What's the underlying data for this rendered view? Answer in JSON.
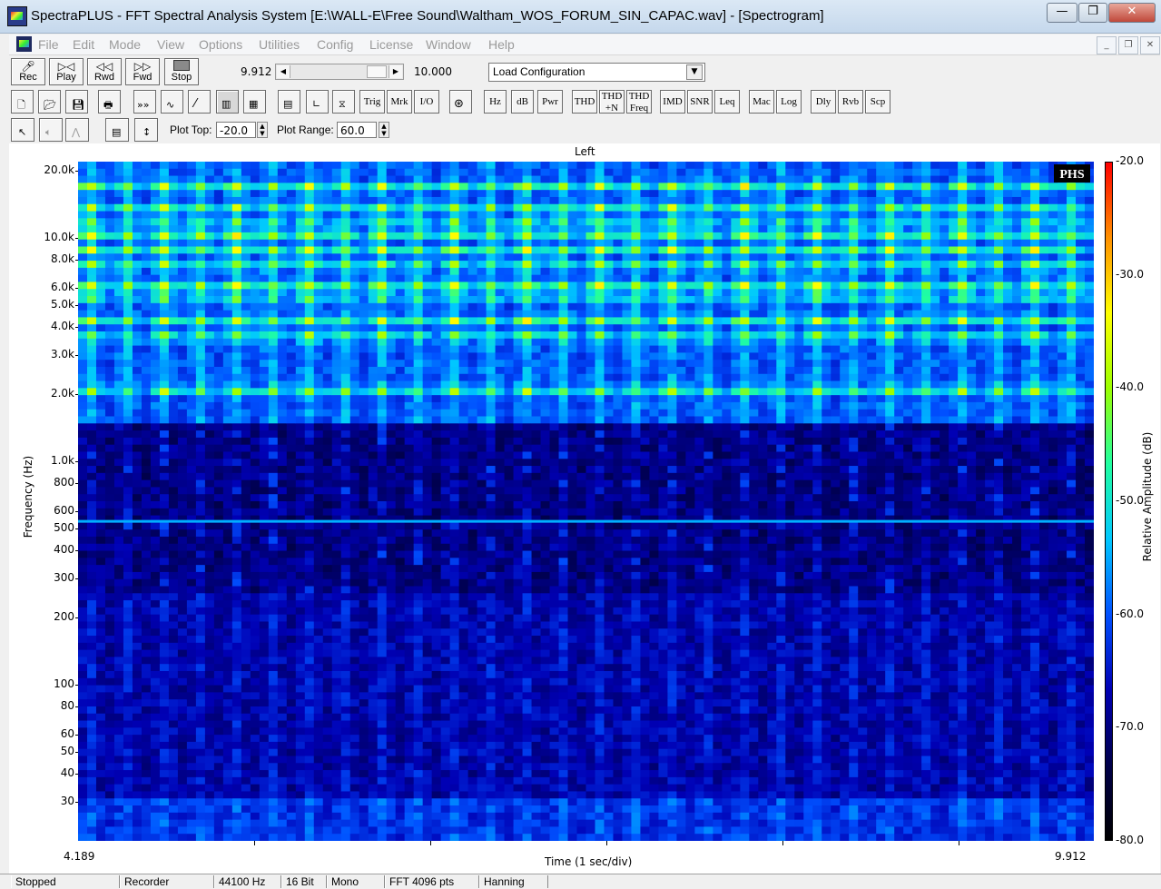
{
  "window": {
    "title": "SpectraPLUS - FFT Spectral Analysis System [E:\\WALL-E\\Free Sound\\Waltham_WOS_FORUM_SIN_CAPAC.wav] - [Spectrogram]",
    "app_icon": "spectrum-app-icon",
    "minimize": "—",
    "maximize": "❐",
    "close": "✕"
  },
  "menu": {
    "items": [
      "File",
      "Edit",
      "Mode",
      "View",
      "Options",
      "Utilities",
      "Config",
      "License",
      "Window",
      "Help"
    ],
    "mdi_min": "_",
    "mdi_restore": "❐",
    "mdi_close": "✕"
  },
  "transport": {
    "rec": "Rec",
    "play": "Play",
    "rwd": "Rwd",
    "fwd": "Fwd",
    "stop": "Stop",
    "position_left": "9.912",
    "position_right": "10.000",
    "scroll_left": "◀",
    "scroll_right": "▶",
    "config_value": "Load Configuration",
    "config_arrow": "▼"
  },
  "toolbar2": {
    "icons": [
      "new-file-icon",
      "open-folder-icon",
      "save-disk-icon",
      "printer-icon",
      "fast-forward-icon",
      "waveform-icon",
      "ramp-icon",
      "spectrogram-icon",
      "3d-plot-icon",
      "panel-icon",
      "ruler-icon",
      "trigger-shape-icon"
    ],
    "trig": "Trig",
    "mrk": "Mrk",
    "io": "I/O",
    "hz": "Hz",
    "db": "dB",
    "pwr": "Pwr",
    "thd": "THD",
    "thdn_top": "THD",
    "thdn_bot": "+N",
    "thdf_top": "THD",
    "thdf_bot": "Freq",
    "imd": "IMD",
    "snr": "SNR",
    "leq": "Leq",
    "mac": "Mac",
    "log": "Log",
    "dly": "Dly",
    "rvb": "Rvb",
    "scp": "Scp"
  },
  "toolbar3": {
    "plot_top_label": "Plot Top:",
    "plot_top_value": "-20.0",
    "plot_range_label": "Plot Range:",
    "plot_range_value": "60.0",
    "spin_up": "▲",
    "spin_down": "▼"
  },
  "colors": {
    "colormap": [
      "#000000",
      "#00004a",
      "#0000b4",
      "#0050ff",
      "#00c8ff",
      "#20ffa0",
      "#9cff00",
      "#ffff00",
      "#ff9000",
      "#ff0000"
    ],
    "plot_bg": "#00003c"
  },
  "chart_data": {
    "type": "heatmap",
    "title": "Left",
    "xlabel": "Time (1 sec/div)",
    "ylabel": "Frequency (Hz)",
    "colorbar_label": "Relative Amplitude (dB)",
    "x_start": "4.189",
    "x_end": "9.912",
    "ylim": [
      20,
      22050
    ],
    "yscale": "log",
    "y_ticks": [
      {
        "label": "20.0k",
        "value": 20000
      },
      {
        "label": "10.0k",
        "value": 10000
      },
      {
        "label": "8.0k",
        "value": 8000
      },
      {
        "label": "6.0k",
        "value": 6000
      },
      {
        "label": "5.0k",
        "value": 5000
      },
      {
        "label": "4.0k",
        "value": 4000
      },
      {
        "label": "3.0k",
        "value": 3000
      },
      {
        "label": "2.0k",
        "value": 2000
      },
      {
        "label": "1.0k",
        "value": 1000
      },
      {
        "label": "800",
        "value": 800
      },
      {
        "label": "600",
        "value": 600
      },
      {
        "label": "500",
        "value": 500
      },
      {
        "label": "400",
        "value": 400
      },
      {
        "label": "300",
        "value": 300
      },
      {
        "label": "200",
        "value": 200
      },
      {
        "label": "100",
        "value": 100
      },
      {
        "label": "80",
        "value": 80
      },
      {
        "label": "60",
        "value": 60
      },
      {
        "label": "50",
        "value": 50
      },
      {
        "label": "40",
        "value": 40
      },
      {
        "label": "30",
        "value": 30
      }
    ],
    "colorbar_ticks": [
      "-20.0",
      "-30.0",
      "-40.0",
      "-50.0",
      "-60.0",
      "-70.0",
      "-80.0"
    ],
    "clim": [
      -80,
      -20
    ],
    "tonal_bands_hz": [
      2100,
      3600,
      4300,
      5500,
      6200,
      7500,
      8800,
      10200,
      11500,
      13500,
      17000
    ],
    "hum_line_hz": 540,
    "pulse_count": 28,
    "watermark": "PHS"
  },
  "status": {
    "state": "Stopped",
    "source": "Recorder",
    "rate": "44100 Hz",
    "bits": "16 Bit",
    "channels": "Mono",
    "fft": "FFT 4096 pts",
    "window": "Hanning"
  }
}
